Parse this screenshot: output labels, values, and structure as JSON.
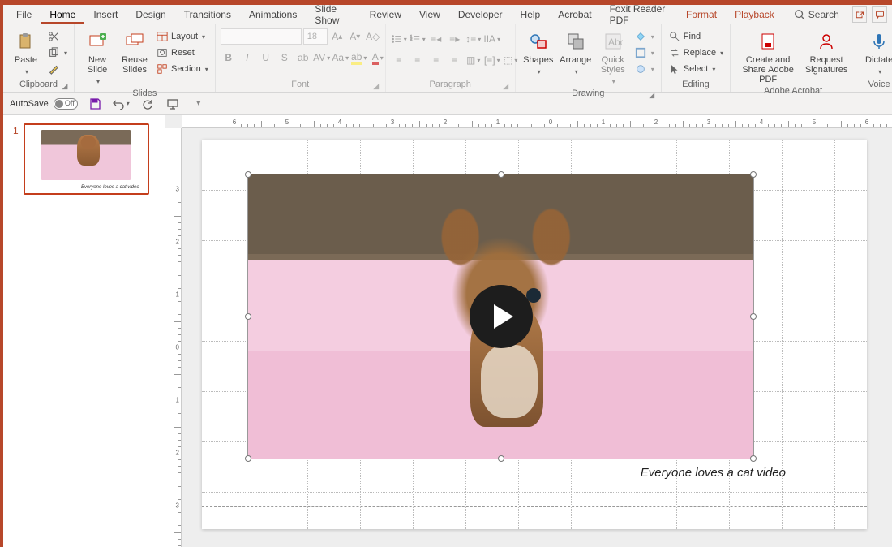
{
  "tabs": {
    "file": "File",
    "home": "Home",
    "insert": "Insert",
    "design": "Design",
    "transitions": "Transitions",
    "animations": "Animations",
    "slideshow": "Slide Show",
    "review": "Review",
    "view": "View",
    "developer": "Developer",
    "help": "Help",
    "acrobat": "Acrobat",
    "foxit": "Foxit Reader PDF",
    "format": "Format",
    "playback": "Playback",
    "search": "Search"
  },
  "ribbon": {
    "clipboard": {
      "label": "Clipboard",
      "paste": "Paste"
    },
    "slides": {
      "label": "Slides",
      "new": "New Slide",
      "reuse": "Reuse Slides",
      "layout": "Layout",
      "reset": "Reset",
      "section": "Section"
    },
    "font": {
      "label": "Font",
      "size": "18"
    },
    "paragraph": {
      "label": "Paragraph"
    },
    "drawing": {
      "label": "Drawing",
      "shapes": "Shapes",
      "arrange": "Arrange",
      "quick": "Quick Styles"
    },
    "editing": {
      "label": "Editing",
      "find": "Find",
      "replace": "Replace",
      "select": "Select"
    },
    "adobe": {
      "label": "Adobe Acrobat",
      "create": "Create and Share Adobe PDF",
      "sig": "Request Signatures"
    },
    "voice": {
      "label": "Voice",
      "dictate": "Dictate"
    }
  },
  "qat": {
    "autosave": "AutoSave",
    "off": "Off"
  },
  "slide": {
    "num": "1",
    "caption": "Everyone loves a cat video"
  },
  "ruler": {
    "ticks": [
      "6",
      "5",
      "4",
      "3",
      "2",
      "1",
      "0",
      "1",
      "2",
      "3",
      "4",
      "5",
      "6"
    ],
    "vticks": [
      "3",
      "2",
      "1",
      "0",
      "1",
      "2",
      "3"
    ]
  }
}
